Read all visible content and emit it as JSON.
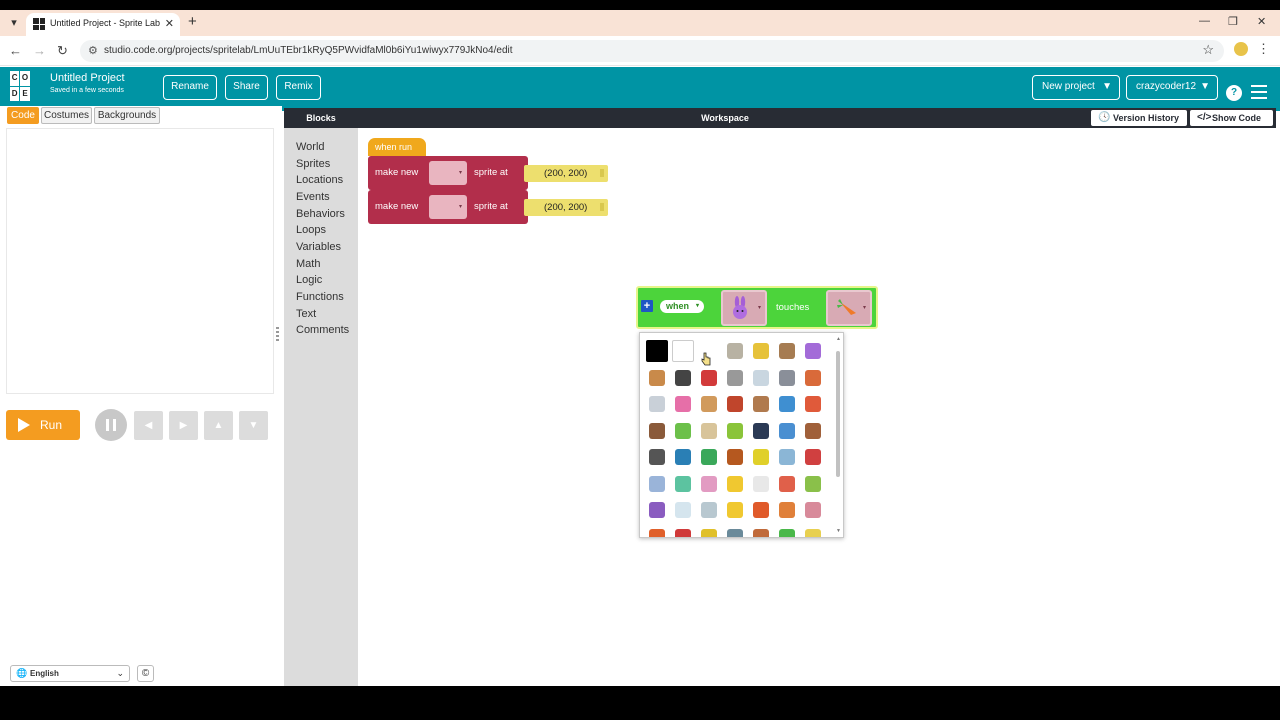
{
  "browser": {
    "tab_title": "Untitled Project - Sprite Lab - C",
    "url": "studio.code.org/projects/spritelab/LmUuTEbr1kRyQ5PWvidfaMl0b6iYu1wiwyx779JkNo4/edit"
  },
  "header": {
    "logo_letters": [
      "C",
      "O",
      "D",
      "E"
    ],
    "project_title": "Untitled Project",
    "save_status": "Saved in a few seconds",
    "rename_label": "Rename",
    "share_label": "Share",
    "remix_label": "Remix",
    "new_project_label": "New project",
    "user_label": "crazycoder12",
    "help_label": "?",
    "accent_color": "#0094a4"
  },
  "left_panel": {
    "tabs": [
      "Code",
      "Costumes",
      "Backgrounds"
    ],
    "active_tab": "Code",
    "run_label": "Run",
    "language": "English"
  },
  "toolbox": {
    "header": "Blocks",
    "categories": [
      "World",
      "Sprites",
      "Locations",
      "Events",
      "Behaviors",
      "Loops",
      "Variables",
      "Math",
      "Logic",
      "Functions",
      "Text",
      "Comments"
    ]
  },
  "workspace": {
    "header": "Workspace",
    "version_history_label": "Version History",
    "show_code_label": "Show Code",
    "hat_label": "when run",
    "block1": {
      "prefix": "make new",
      "suffix": "sprite at",
      "location": "(200, 200)"
    },
    "block2": {
      "prefix": "make new",
      "suffix": "sprite at",
      "location": "(200, 200)"
    },
    "event_block": {
      "when_label": "when",
      "touches_label": "touches",
      "left_costume": "purple-bunny",
      "right_costume": "carrot"
    }
  },
  "picker": {
    "colors": [
      "#000000",
      "#ffffff",
      "#ffffff",
      "#b8b2a3",
      "#e6c23a",
      "#a67c52",
      "#a36bd8",
      "#c98a4a",
      "#444444",
      "#d23a3a",
      "#999999",
      "#c9d6e0",
      "#8a8f99",
      "#d96a3a",
      "#c9d0d8",
      "#e66fa8",
      "#d19a5c",
      "#c0452c",
      "#b07a4e",
      "#3f8fd1",
      "#e05a3a",
      "#8a5a3a",
      "#6cc04a",
      "#d8c49a",
      "#8ac43a",
      "#2b3a55",
      "#4a8fd1",
      "#a0603a",
      "#555555",
      "#2a7fb5",
      "#3aa85a",
      "#b5581f",
      "#e0d02a",
      "#8bb6d6",
      "#d04040",
      "#9ab4d9",
      "#5cc3a0",
      "#e29bc2",
      "#f0c830",
      "#e8e8e8",
      "#e0604a",
      "#8ac04a",
      "#8a5cc0",
      "#d5e5ee",
      "#b8c8d0",
      "#f0c830",
      "#e05a2a",
      "#e0803a",
      "#d88a9a",
      "#e0602a",
      "#d03a3a",
      "#e0c02a",
      "#6a8a9a",
      "#c06a3a",
      "#4ab84a",
      "#e8d050"
    ]
  }
}
